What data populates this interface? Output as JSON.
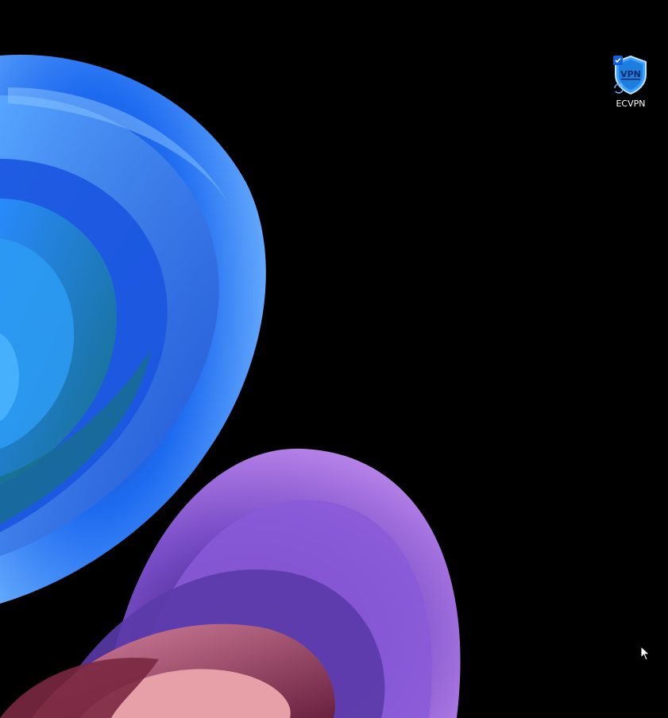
{
  "desktop": {
    "background_color": "#000000",
    "wallpaper_colors": {
      "blue_light": "#6fb3ff",
      "blue_mid": "#1f6cf0",
      "blue_dark": "#0a2a9a",
      "teal": "#1b7a8f",
      "purple_light": "#c48ef0",
      "purple_mid": "#7a4ec8",
      "pink": "#e08aa0",
      "maroon": "#6a1f3a"
    },
    "icons": [
      {
        "label": "ECVPN",
        "icon": "vpn-shield-icon",
        "badge_text": "VPN",
        "overlay": "sync-arrows-icon",
        "check_badge": "checkmark-badge-icon",
        "shield_color": "#3aa0ff"
      }
    ],
    "cursor": "arrow-cursor-icon"
  }
}
